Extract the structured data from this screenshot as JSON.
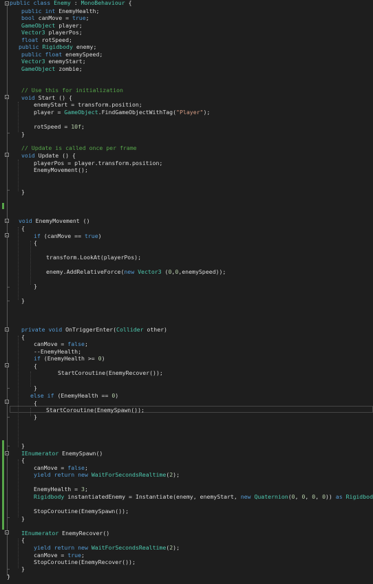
{
  "editor": {
    "colors": {
      "background": "#1e1e1e",
      "keyword": "#569cd6",
      "type": "#4ec9b0",
      "comment": "#57a64a",
      "string": "#d69d85",
      "number": "#b5cea8",
      "plain": "#dcdcdc",
      "change_bar": "#57a64a"
    },
    "lines": [
      [
        {
          "t": "public",
          "c": "kw"
        },
        {
          "t": " "
        },
        {
          "t": "class",
          "c": "kw"
        },
        {
          "t": " "
        },
        {
          "t": "Enemy",
          "c": "ty"
        },
        {
          "t": " : "
        },
        {
          "t": "MonoBehaviour",
          "c": "ty"
        },
        {
          "t": " {"
        }
      ],
      [
        {
          "t": "public",
          "c": "kw"
        },
        {
          "t": " "
        },
        {
          "t": "int",
          "c": "kw"
        },
        {
          "t": " EnemyHealth;"
        }
      ],
      [
        {
          "t": "bool",
          "c": "kw"
        },
        {
          "t": " canMove = "
        },
        {
          "t": "true",
          "c": "kw"
        },
        {
          "t": ";"
        }
      ],
      [
        {
          "t": "GameObject",
          "c": "ty"
        },
        {
          "t": " player;"
        }
      ],
      [
        {
          "t": "Vector3",
          "c": "ty"
        },
        {
          "t": " playerPos;"
        }
      ],
      [
        {
          "t": "float",
          "c": "kw"
        },
        {
          "t": " rotSpeed;"
        }
      ],
      [
        {
          "t": "public",
          "c": "kw"
        },
        {
          "t": " "
        },
        {
          "t": "Rigidbody",
          "c": "ty"
        },
        {
          "t": " enemy;"
        }
      ],
      [
        {
          "t": "public",
          "c": "kw"
        },
        {
          "t": " "
        },
        {
          "t": "float",
          "c": "kw"
        },
        {
          "t": " enemySpeed;"
        }
      ],
      [
        {
          "t": "Vector3",
          "c": "ty"
        },
        {
          "t": " enemyStart;"
        }
      ],
      [
        {
          "t": "GameObject",
          "c": "ty"
        },
        {
          "t": " zombie;"
        }
      ],
      [
        {
          "t": "// Use this for initialization",
          "c": "cm"
        }
      ],
      [
        {
          "t": "void",
          "c": "kw"
        },
        {
          "t": " Start () {"
        }
      ],
      [
        {
          "t": "enemyStart = transform.position;"
        }
      ],
      [
        {
          "t": "player = "
        },
        {
          "t": "GameObject",
          "c": "ty"
        },
        {
          "t": ".FindGameObjectWithTag("
        },
        {
          "t": "\"Player\"",
          "c": "st"
        },
        {
          "t": ");"
        }
      ],
      [
        {
          "t": "rotSpeed = "
        },
        {
          "t": "10f",
          "c": "nm"
        },
        {
          "t": ";"
        }
      ],
      [
        {
          "t": "}"
        }
      ],
      [
        {
          "t": "// Update is called once per frame",
          "c": "cm"
        }
      ],
      [
        {
          "t": "void",
          "c": "kw"
        },
        {
          "t": " Update () {"
        }
      ],
      [
        {
          "t": "playerPos = player.transform.position;"
        }
      ],
      [
        {
          "t": "EnemyMovement();"
        }
      ],
      [
        {
          "t": "}"
        }
      ],
      [
        {
          "t": "void",
          "c": "kw"
        },
        {
          "t": " EnemyMovement ()"
        }
      ],
      [
        {
          "t": "{"
        }
      ],
      [
        {
          "t": "if",
          "c": "kw"
        },
        {
          "t": " (canMove == "
        },
        {
          "t": "true",
          "c": "kw"
        },
        {
          "t": ")"
        }
      ],
      [
        {
          "t": "{"
        }
      ],
      [
        {
          "t": "transform.LookAt(playerPos);"
        }
      ],
      [
        {
          "t": "enemy.AddRelativeForce("
        },
        {
          "t": "new",
          "c": "kw"
        },
        {
          "t": " "
        },
        {
          "t": "Vector3",
          "c": "ty"
        },
        {
          "t": " ("
        },
        {
          "t": "0",
          "c": "nm"
        },
        {
          "t": ","
        },
        {
          "t": "0",
          "c": "nm"
        },
        {
          "t": ",enemySpeed));"
        }
      ],
      [
        {
          "t": "}"
        }
      ],
      [
        {
          "t": "}"
        }
      ],
      [
        {
          "t": "private",
          "c": "kw"
        },
        {
          "t": " "
        },
        {
          "t": "void",
          "c": "kw"
        },
        {
          "t": " OnTriggerEnter("
        },
        {
          "t": "Collider",
          "c": "ty"
        },
        {
          "t": " other)"
        }
      ],
      [
        {
          "t": "{"
        }
      ],
      [
        {
          "t": "canMove = "
        },
        {
          "t": "false",
          "c": "kw"
        },
        {
          "t": ";"
        }
      ],
      [
        {
          "t": "--EnemyHealth;"
        }
      ],
      [
        {
          "t": "if",
          "c": "kw"
        },
        {
          "t": " (EnemyHealth >= "
        },
        {
          "t": "0",
          "c": "nm"
        },
        {
          "t": ")"
        }
      ],
      [
        {
          "t": "{"
        }
      ],
      [
        {
          "t": "StartCoroutine(EnemyRecover());"
        }
      ],
      [
        {
          "t": "}"
        }
      ],
      [
        {
          "t": "else",
          "c": "kw"
        },
        {
          "t": " "
        },
        {
          "t": "if",
          "c": "kw"
        },
        {
          "t": " (EnemyHealth == "
        },
        {
          "t": "0",
          "c": "nm"
        },
        {
          "t": ")"
        }
      ],
      [
        {
          "t": "{"
        }
      ],
      [
        {
          "t": "StartCoroutine(EnemySpawn());"
        }
      ],
      [
        {
          "t": "}"
        }
      ],
      [
        {
          "t": "}"
        }
      ],
      [
        {
          "t": "IEnumerator",
          "c": "ty"
        },
        {
          "t": " EnemySpawn()"
        }
      ],
      [
        {
          "t": "{"
        }
      ],
      [
        {
          "t": "canMove = "
        },
        {
          "t": "false",
          "c": "kw"
        },
        {
          "t": ";"
        }
      ],
      [
        {
          "t": "yield",
          "c": "kw"
        },
        {
          "t": " "
        },
        {
          "t": "return",
          "c": "kw"
        },
        {
          "t": " "
        },
        {
          "t": "new",
          "c": "kw"
        },
        {
          "t": " "
        },
        {
          "t": "WaitForSecondsRealtime",
          "c": "ty"
        },
        {
          "t": "("
        },
        {
          "t": "2",
          "c": "nm"
        },
        {
          "t": ");"
        }
      ],
      [
        {
          "t": "EnemyHealth = "
        },
        {
          "t": "3",
          "c": "nm"
        },
        {
          "t": ";"
        }
      ],
      [
        {
          "t": "Rigidbody",
          "c": "ty"
        },
        {
          "t": " instantiatedEnemy = Instantiate(enemy, enemyStart, "
        },
        {
          "t": "new",
          "c": "kw"
        },
        {
          "t": " "
        },
        {
          "t": "Quaternion",
          "c": "ty"
        },
        {
          "t": "("
        },
        {
          "t": "0",
          "c": "nm"
        },
        {
          "t": ", "
        },
        {
          "t": "0",
          "c": "nm"
        },
        {
          "t": ", "
        },
        {
          "t": "0",
          "c": "nm"
        },
        {
          "t": ", "
        },
        {
          "t": "0",
          "c": "nm"
        },
        {
          "t": ")) "
        },
        {
          "t": "as",
          "c": "kw"
        },
        {
          "t": " "
        },
        {
          "t": "Rigidbody",
          "c": "ty"
        },
        {
          "t": ";"
        }
      ],
      [
        {
          "t": "StopCoroutine(EnemySpawn());"
        }
      ],
      [
        {
          "t": "}"
        }
      ],
      [
        {
          "t": "IEnumerator",
          "c": "ty"
        },
        {
          "t": " EnemyRecover()"
        }
      ],
      [
        {
          "t": "{"
        }
      ],
      [
        {
          "t": "yield",
          "c": "kw"
        },
        {
          "t": " "
        },
        {
          "t": "return",
          "c": "kw"
        },
        {
          "t": " "
        },
        {
          "t": "new",
          "c": "kw"
        },
        {
          "t": " "
        },
        {
          "t": "WaitForSecondsRealtime",
          "c": "ty"
        },
        {
          "t": "("
        },
        {
          "t": "2",
          "c": "nm"
        },
        {
          "t": ");"
        }
      ],
      [
        {
          "t": "canMove = "
        },
        {
          "t": "true",
          "c": "kw"
        },
        {
          "t": ";"
        }
      ],
      [
        {
          "t": "StopCoroutine(EnemyRecover());"
        }
      ],
      [
        {
          "t": "}"
        }
      ],
      [
        {
          "t": "}"
        }
      ]
    ]
  }
}
